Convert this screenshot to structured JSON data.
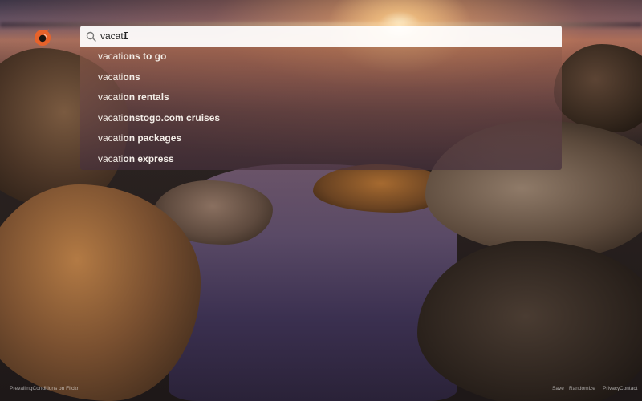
{
  "search": {
    "value": "vacati",
    "placeholder": ""
  },
  "suggestions": [
    {
      "typed": "vacati",
      "rest": "ons to go"
    },
    {
      "typed": "vacati",
      "rest": "ons"
    },
    {
      "typed": "vacati",
      "rest": "on rentals"
    },
    {
      "typed": "vacati",
      "rest": "onstogo.com cruises"
    },
    {
      "typed": "vacati",
      "rest": "on packages"
    },
    {
      "typed": "vacati",
      "rest": "on express"
    }
  ],
  "footer": {
    "credit": "PrevailingConditions on Flickr",
    "save": "Save",
    "randomize": "Randomize",
    "privacy": "Privacy",
    "contact": "Contact"
  },
  "colors": {
    "logo_accent": "#e8622a",
    "search_bg": "#ffffff",
    "suggestion_text": "#f4eee8"
  },
  "icons": {
    "logo": "flame-logo-icon",
    "search": "search-icon",
    "cursor": "text-cursor-icon"
  }
}
